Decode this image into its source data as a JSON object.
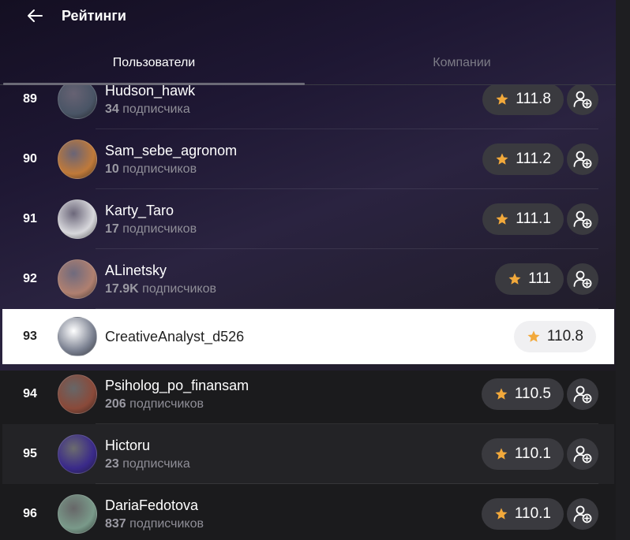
{
  "header": {
    "title": "Рейтинги"
  },
  "tabs": [
    {
      "label": "Пользователи",
      "active": true
    },
    {
      "label": "Компании",
      "active": false
    }
  ],
  "colors": {
    "accent_star": "#f2a93b",
    "highlight_row": "#ffffff"
  },
  "rows": [
    {
      "rank": "89",
      "name": "Hudson_hawk",
      "subs_count": "34",
      "subs_label": "подписчика",
      "rating": "111.8",
      "avatar": "#4a5566",
      "followable": true
    },
    {
      "rank": "90",
      "name": "Sam_sebe_agronom",
      "subs_count": "10",
      "subs_label": "подписчиков",
      "rating": "111.2",
      "avatar": "#c07a3a",
      "followable": true
    },
    {
      "rank": "91",
      "name": "Karty_Taro",
      "subs_count": "17",
      "subs_label": "подписчиков",
      "rating": "111.1",
      "avatar": "#d8d8dc",
      "followable": true
    },
    {
      "rank": "92",
      "name": "ALinetsky",
      "subs_count": "17.9K",
      "subs_label": "подписчиков",
      "rating": "111",
      "avatar": "#b08070",
      "followable": true
    },
    {
      "rank": "93",
      "name": "CreativeAnalyst_d526",
      "subs_count": "",
      "subs_label": "",
      "rating": "110.8",
      "avatar": "#7a8090",
      "followable": false,
      "highlight": true
    },
    {
      "rank": "94",
      "name": "Psiholog_po_finansam",
      "subs_count": "206",
      "subs_label": "подписчиков",
      "rating": "110.5",
      "avatar": "#8a4a3a",
      "followable": true
    },
    {
      "rank": "95",
      "name": "Hictoru",
      "subs_count": "23",
      "subs_label": "подписчика",
      "rating": "110.1",
      "avatar": "#3a2a8a",
      "followable": true,
      "alt": true
    },
    {
      "rank": "96",
      "name": "DariaFedotova",
      "subs_count": "837",
      "subs_label": "подписчиков",
      "rating": "110.1",
      "avatar": "#7a9a8a",
      "followable": true
    }
  ]
}
